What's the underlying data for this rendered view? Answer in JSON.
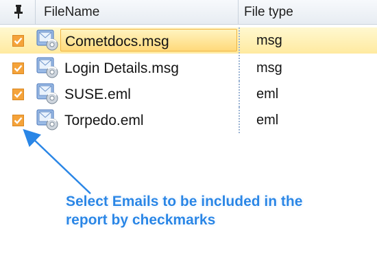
{
  "columns": {
    "pin_icon": "pin-icon",
    "filename": "FileName",
    "filetype": "File type"
  },
  "rows": [
    {
      "name": "Cometdocs.msg",
      "type": "msg",
      "checked": true,
      "selected": true,
      "icon": "email-file-icon"
    },
    {
      "name": "Login Details.msg",
      "type": "msg",
      "checked": true,
      "selected": false,
      "icon": "email-file-icon"
    },
    {
      "name": "SUSE.eml",
      "type": "eml",
      "checked": true,
      "selected": false,
      "icon": "email-file-icon"
    },
    {
      "name": "Torpedo.eml",
      "type": "eml",
      "checked": true,
      "selected": false,
      "icon": "email-file-icon"
    }
  ],
  "annotation": {
    "line1": "Select Emails to be included in the",
    "line2": "report by checkmarks"
  },
  "colors": {
    "checkbox": "#f5a33a",
    "annotation": "#2a86e6",
    "selected_row": "#ffe9a0"
  }
}
